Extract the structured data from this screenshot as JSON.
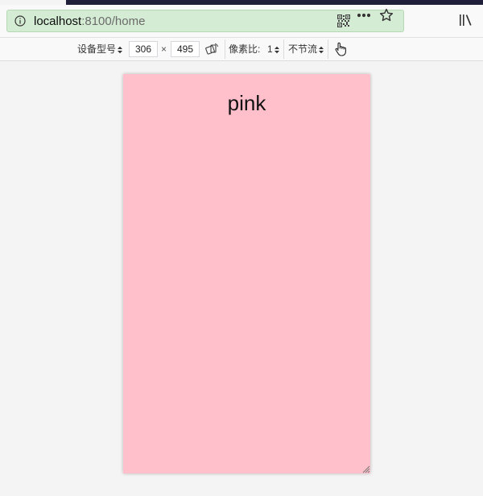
{
  "browser": {
    "url_host": "localhost",
    "url_path": ":8100/home",
    "icons": {
      "info": "info-icon",
      "qr": "qr-code-icon",
      "page_actions": "more-dots-icon",
      "bookmark": "star-icon",
      "library": "library-icon"
    },
    "colors": {
      "urlbar_bg": "#d5ecd4",
      "top_strip": "#1f1f3a"
    }
  },
  "rdm": {
    "device_label": "设备型号",
    "width": "306",
    "times": "×",
    "height": "495",
    "rotate_icon": "rotate-icon",
    "dpr_label": "像素比:",
    "dpr_value": "1",
    "throttle_label": "不节流",
    "touch_icon": "touch-hand-icon"
  },
  "viewport": {
    "background": "#ffc0cb",
    "title": "pink"
  }
}
